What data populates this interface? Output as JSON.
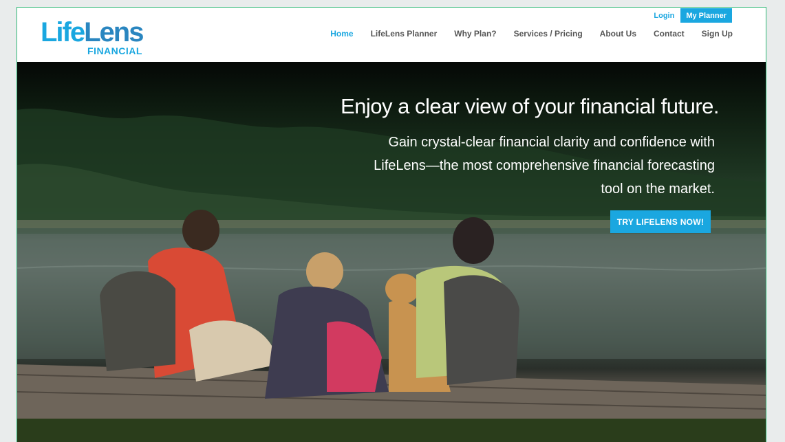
{
  "logo": {
    "life": "Life",
    "lens": "Lens",
    "sub": "FINANCIAL"
  },
  "util": {
    "login": "Login",
    "planner": "My Planner"
  },
  "nav": {
    "home": "Home",
    "planner": "LifeLens Planner",
    "why": "Why Plan?",
    "services": "Services / Pricing",
    "about": "About Us",
    "contact": "Contact",
    "signup": "Sign Up"
  },
  "hero": {
    "title": "Enjoy a clear view of your financial future.",
    "subtitle": "Gain crystal-clear financial clarity and confidence with LifeLens—the most comprehensive financial forecasting tool on the market.",
    "cta": "TRY LIFELENS NOW!"
  },
  "colors": {
    "accent": "#1aa7e0",
    "border": "#2bb673",
    "footer": "#2a3d1b"
  }
}
